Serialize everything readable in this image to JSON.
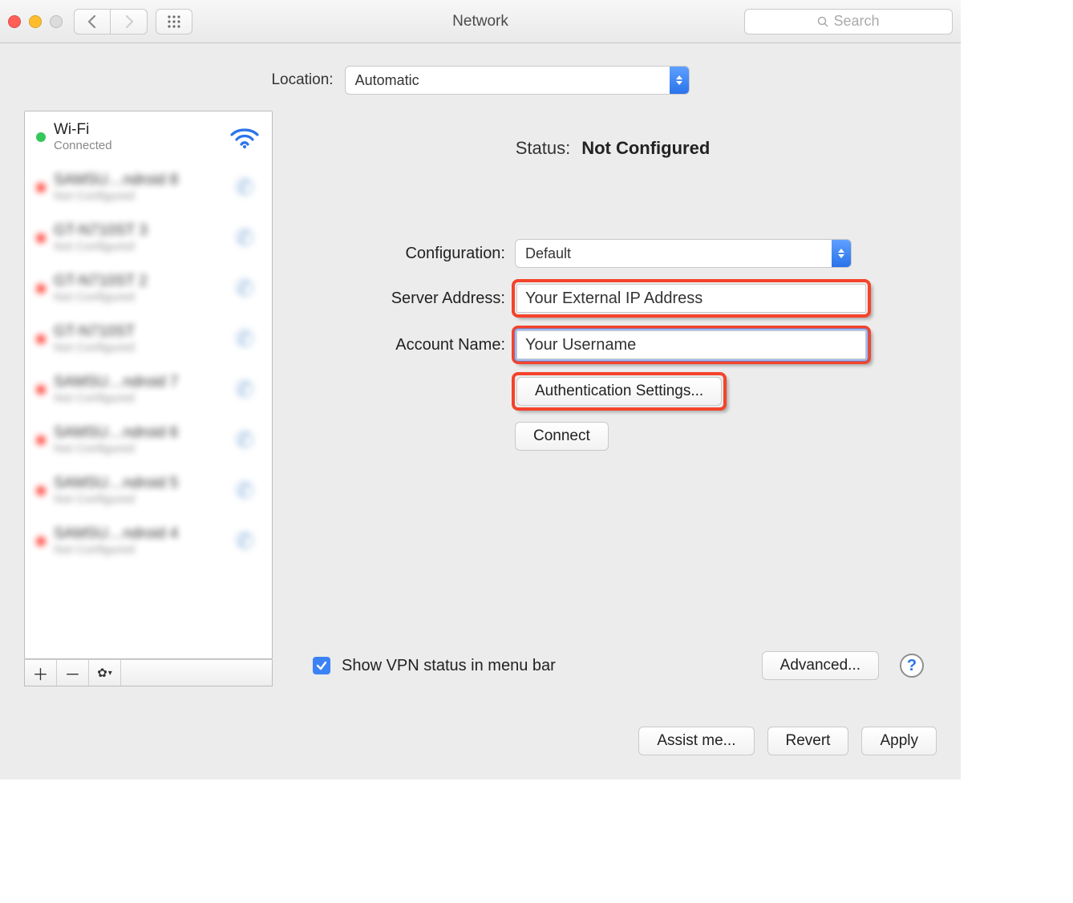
{
  "window": {
    "title": "Network"
  },
  "search": {
    "placeholder": "Search"
  },
  "location": {
    "label": "Location:",
    "value": "Automatic"
  },
  "sidebar": {
    "wifi": {
      "name": "Wi-Fi",
      "status": "Connected"
    }
  },
  "detail": {
    "status_label": "Status:",
    "status_value": "Not Configured",
    "config_label": "Configuration:",
    "config_value": "Default",
    "server_label": "Server Address:",
    "server_value": "Your External IP Address",
    "account_label": "Account Name:",
    "account_value": "Your Username",
    "auth_button": "Authentication Settings...",
    "connect_button": "Connect",
    "show_vpn_label": "Show VPN status in menu bar",
    "advanced_button": "Advanced..."
  },
  "footer": {
    "assist": "Assist me...",
    "revert": "Revert",
    "apply": "Apply"
  }
}
